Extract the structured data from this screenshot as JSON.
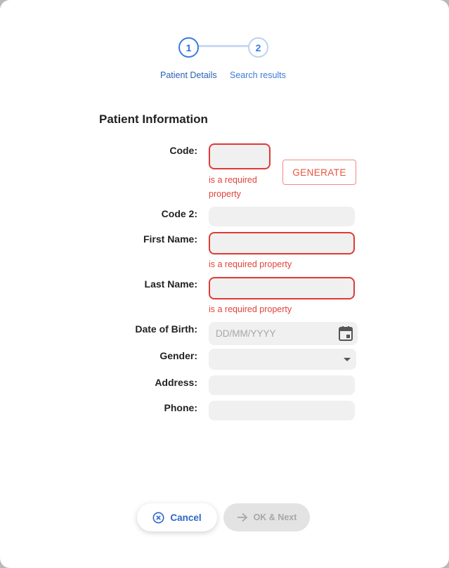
{
  "stepper": {
    "steps": [
      {
        "number": "1",
        "label": "Patient Details",
        "state": "active"
      },
      {
        "number": "2",
        "label": "Search results",
        "state": "inactive"
      }
    ]
  },
  "form": {
    "section_title": "Patient Information",
    "code": {
      "label": "Code:",
      "value": "",
      "error": "is a required property"
    },
    "generate_label": "GENERATE",
    "code2": {
      "label": "Code 2:",
      "value": ""
    },
    "first_name": {
      "label": "First Name:",
      "value": "",
      "error": "is a required property"
    },
    "last_name": {
      "label": "Last Name:",
      "value": "",
      "error": "is a required property"
    },
    "dob": {
      "label": "Date of Birth:",
      "placeholder": "DD/MM/YYYY"
    },
    "gender": {
      "label": "Gender:",
      "value": ""
    },
    "address": {
      "label": "Address:",
      "value": ""
    },
    "phone": {
      "label": "Phone:",
      "value": ""
    }
  },
  "footer": {
    "cancel_label": "Cancel",
    "next_label": "OK & Next"
  },
  "colors": {
    "primary": "#2e6fd6",
    "error": "#df3a35",
    "disabled": "#e3e3e4"
  },
  "icons": {
    "cancel": "circle-x-icon",
    "next": "arrow-right-icon",
    "date": "calendar-icon",
    "gender": "caret-down-icon"
  }
}
